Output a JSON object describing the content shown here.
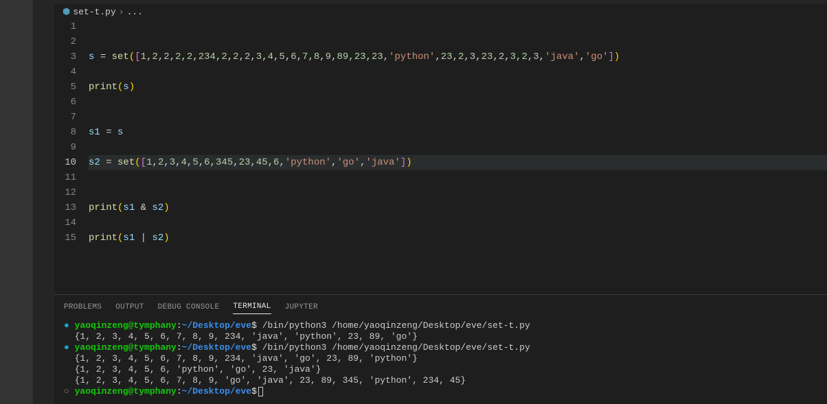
{
  "breadcrumb": {
    "filename": "set-t.py",
    "trail": "..."
  },
  "editor": {
    "activeLine": 10,
    "lines": [
      {
        "n": 1,
        "tokens": []
      },
      {
        "n": 2,
        "tokens": []
      },
      {
        "n": 3,
        "tokens": [
          {
            "t": "var",
            "v": "s"
          },
          {
            "t": "sp",
            "v": " "
          },
          {
            "t": "op",
            "v": "="
          },
          {
            "t": "sp",
            "v": " "
          },
          {
            "t": "func",
            "v": "set"
          },
          {
            "t": "b1o",
            "v": "("
          },
          {
            "t": "b2o",
            "v": "["
          },
          {
            "t": "num",
            "v": "1"
          },
          {
            "t": "punct",
            "v": ","
          },
          {
            "t": "num",
            "v": "2"
          },
          {
            "t": "punct",
            "v": ","
          },
          {
            "t": "num",
            "v": "2"
          },
          {
            "t": "punct",
            "v": ","
          },
          {
            "t": "num",
            "v": "2"
          },
          {
            "t": "punct",
            "v": ","
          },
          {
            "t": "num",
            "v": "2"
          },
          {
            "t": "punct",
            "v": ","
          },
          {
            "t": "num",
            "v": "234"
          },
          {
            "t": "punct",
            "v": ","
          },
          {
            "t": "num",
            "v": "2"
          },
          {
            "t": "punct",
            "v": ","
          },
          {
            "t": "num",
            "v": "2"
          },
          {
            "t": "punct",
            "v": ","
          },
          {
            "t": "num",
            "v": "2"
          },
          {
            "t": "punct",
            "v": ","
          },
          {
            "t": "num",
            "v": "3"
          },
          {
            "t": "punct",
            "v": ","
          },
          {
            "t": "num",
            "v": "4"
          },
          {
            "t": "punct",
            "v": ","
          },
          {
            "t": "num",
            "v": "5"
          },
          {
            "t": "punct",
            "v": ","
          },
          {
            "t": "num",
            "v": "6"
          },
          {
            "t": "punct",
            "v": ","
          },
          {
            "t": "num",
            "v": "7"
          },
          {
            "t": "punct",
            "v": ","
          },
          {
            "t": "num",
            "v": "8"
          },
          {
            "t": "punct",
            "v": ","
          },
          {
            "t": "num",
            "v": "9"
          },
          {
            "t": "punct",
            "v": ","
          },
          {
            "t": "num",
            "v": "89"
          },
          {
            "t": "punct",
            "v": ","
          },
          {
            "t": "num",
            "v": "23"
          },
          {
            "t": "punct",
            "v": ","
          },
          {
            "t": "num",
            "v": "23"
          },
          {
            "t": "punct",
            "v": ","
          },
          {
            "t": "str",
            "v": "'python'"
          },
          {
            "t": "punct",
            "v": ","
          },
          {
            "t": "num",
            "v": "23"
          },
          {
            "t": "punct",
            "v": ","
          },
          {
            "t": "num",
            "v": "2"
          },
          {
            "t": "punct",
            "v": ","
          },
          {
            "t": "num",
            "v": "3"
          },
          {
            "t": "punct",
            "v": ","
          },
          {
            "t": "num",
            "v": "23"
          },
          {
            "t": "punct",
            "v": ","
          },
          {
            "t": "num",
            "v": "2"
          },
          {
            "t": "punct",
            "v": ","
          },
          {
            "t": "num",
            "v": "3"
          },
          {
            "t": "punct",
            "v": ","
          },
          {
            "t": "num",
            "v": "2"
          },
          {
            "t": "punct",
            "v": ","
          },
          {
            "t": "num",
            "v": "3"
          },
          {
            "t": "punct",
            "v": ","
          },
          {
            "t": "str",
            "v": "'java'"
          },
          {
            "t": "punct",
            "v": ","
          },
          {
            "t": "str",
            "v": "'go'"
          },
          {
            "t": "b2c",
            "v": "]"
          },
          {
            "t": "b1c",
            "v": ")"
          }
        ]
      },
      {
        "n": 4,
        "tokens": []
      },
      {
        "n": 5,
        "tokens": [
          {
            "t": "func",
            "v": "print"
          },
          {
            "t": "b1o",
            "v": "("
          },
          {
            "t": "var",
            "v": "s"
          },
          {
            "t": "b1c",
            "v": ")"
          }
        ]
      },
      {
        "n": 6,
        "tokens": []
      },
      {
        "n": 7,
        "tokens": []
      },
      {
        "n": 8,
        "tokens": [
          {
            "t": "var",
            "v": "s1"
          },
          {
            "t": "sp",
            "v": " "
          },
          {
            "t": "op",
            "v": "="
          },
          {
            "t": "sp",
            "v": " "
          },
          {
            "t": "var",
            "v": "s"
          }
        ]
      },
      {
        "n": 9,
        "tokens": []
      },
      {
        "n": 10,
        "tokens": [
          {
            "t": "var",
            "v": "s2"
          },
          {
            "t": "sp",
            "v": " "
          },
          {
            "t": "op",
            "v": "="
          },
          {
            "t": "sp",
            "v": " "
          },
          {
            "t": "func",
            "v": "set"
          },
          {
            "t": "b1o",
            "v": "("
          },
          {
            "t": "b2o",
            "v": "["
          },
          {
            "t": "num",
            "v": "1"
          },
          {
            "t": "punct",
            "v": ","
          },
          {
            "t": "num",
            "v": "2"
          },
          {
            "t": "punct",
            "v": ","
          },
          {
            "t": "num",
            "v": "3"
          },
          {
            "t": "punct",
            "v": ","
          },
          {
            "t": "num",
            "v": "4"
          },
          {
            "t": "punct",
            "v": ","
          },
          {
            "t": "num",
            "v": "5"
          },
          {
            "t": "punct",
            "v": ","
          },
          {
            "t": "num",
            "v": "6"
          },
          {
            "t": "punct",
            "v": ","
          },
          {
            "t": "num",
            "v": "345"
          },
          {
            "t": "punct",
            "v": ","
          },
          {
            "t": "num",
            "v": "23"
          },
          {
            "t": "punct",
            "v": ","
          },
          {
            "t": "num",
            "v": "45"
          },
          {
            "t": "punct",
            "v": ","
          },
          {
            "t": "num",
            "v": "6"
          },
          {
            "t": "punct",
            "v": ","
          },
          {
            "t": "str",
            "v": "'python'"
          },
          {
            "t": "punct",
            "v": ","
          },
          {
            "t": "str",
            "v": "'go'"
          },
          {
            "t": "punct",
            "v": ","
          },
          {
            "t": "str",
            "v": "'java'"
          },
          {
            "t": "b2c",
            "v": "]"
          },
          {
            "t": "b1c",
            "v": ")"
          }
        ]
      },
      {
        "n": 11,
        "tokens": []
      },
      {
        "n": 12,
        "tokens": []
      },
      {
        "n": 13,
        "tokens": [
          {
            "t": "func",
            "v": "print"
          },
          {
            "t": "b1o",
            "v": "("
          },
          {
            "t": "var",
            "v": "s1"
          },
          {
            "t": "sp",
            "v": " "
          },
          {
            "t": "op",
            "v": "&"
          },
          {
            "t": "sp",
            "v": " "
          },
          {
            "t": "var",
            "v": "s2"
          },
          {
            "t": "b1c",
            "v": ")"
          }
        ]
      },
      {
        "n": 14,
        "tokens": []
      },
      {
        "n": 15,
        "tokens": [
          {
            "t": "func",
            "v": "print"
          },
          {
            "t": "b1o",
            "v": "("
          },
          {
            "t": "var",
            "v": "s1"
          },
          {
            "t": "sp",
            "v": " "
          },
          {
            "t": "op",
            "v": "|"
          },
          {
            "t": "sp",
            "v": " "
          },
          {
            "t": "var",
            "v": "s2"
          },
          {
            "t": "b1c",
            "v": ")"
          }
        ]
      }
    ]
  },
  "panel": {
    "tabs": [
      {
        "label": "PROBLEMS",
        "active": false
      },
      {
        "label": "OUTPUT",
        "active": false
      },
      {
        "label": "DEBUG CONSOLE",
        "active": false
      },
      {
        "label": "TERMINAL",
        "active": true
      },
      {
        "label": "JUPYTER",
        "active": false
      }
    ]
  },
  "terminal": {
    "prompt": {
      "user": "yaoqinzeng@tymphany",
      "path": "~/Desktop/eve",
      "dollar": "$"
    },
    "lines": [
      {
        "type": "prompt",
        "bullet": "cyan",
        "cmd": " /bin/python3 /home/yaoqinzeng/Desktop/eve/set-t.py"
      },
      {
        "type": "out",
        "text": "  {1, 2, 3, 4, 5, 6, 7, 8, 9, 234, 'java', 'python', 23, 89, 'go'}"
      },
      {
        "type": "prompt",
        "bullet": "cyan",
        "cmd": " /bin/python3 /home/yaoqinzeng/Desktop/eve/set-t.py"
      },
      {
        "type": "out",
        "text": "  {1, 2, 3, 4, 5, 6, 7, 8, 9, 234, 'java', 'go', 23, 89, 'python'}"
      },
      {
        "type": "out",
        "text": "  {1, 2, 3, 4, 5, 6, 'python', 'go', 23, 'java'}"
      },
      {
        "type": "out",
        "text": "  {1, 2, 3, 4, 5, 6, 7, 8, 9, 'go', 'java', 23, 89, 345, 'python', 234, 45}"
      },
      {
        "type": "prompt",
        "bullet": "gray",
        "cmd": "",
        "cursor": true
      }
    ]
  }
}
